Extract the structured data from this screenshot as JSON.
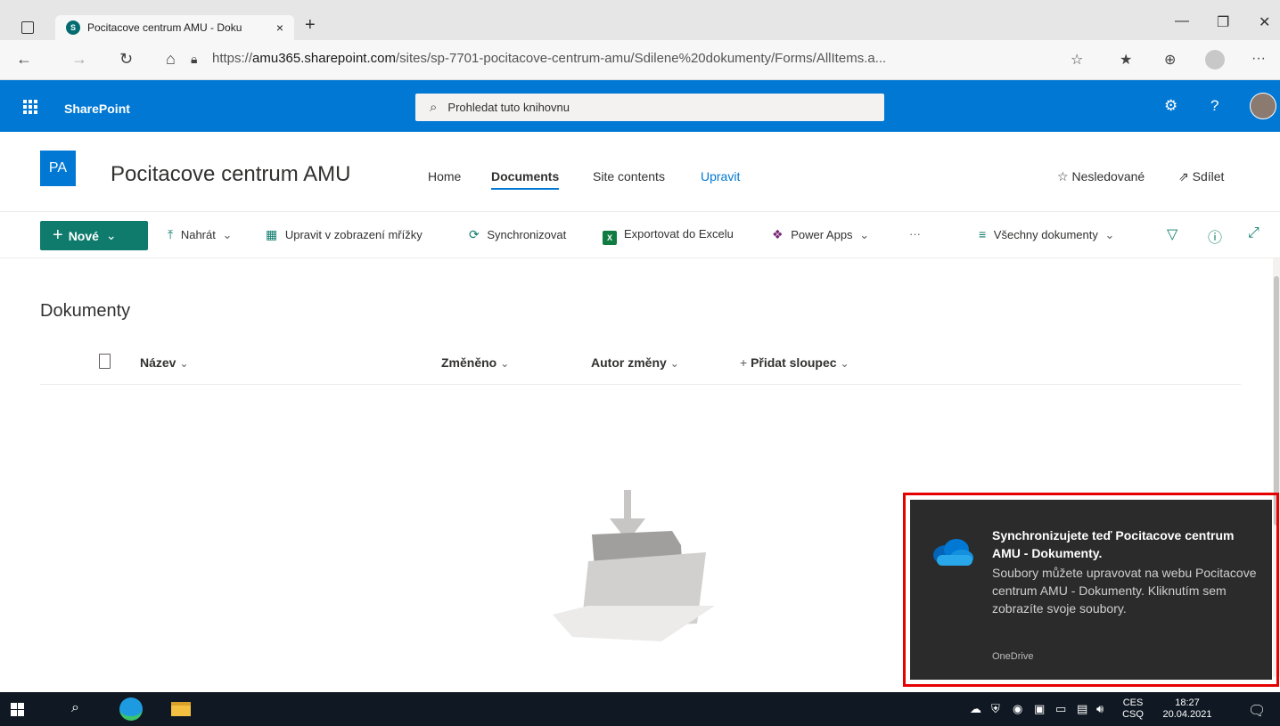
{
  "browser": {
    "tab_title": "Pocitacove centrum AMU - Doku",
    "tab_close": "×",
    "new_tab": "+",
    "url_prefix": "https://",
    "url_host": "amu365.sharepoint.com",
    "url_path": "/sites/sp-7701-pocitacove-centrum-amu/Sdilene%20dokumenty/Forms/AllItems.a...",
    "more": "···"
  },
  "suite": {
    "brand": "SharePoint",
    "search_placeholder": "Prohledat tuto knihovnu",
    "help": "?"
  },
  "site": {
    "logo": "PA",
    "title": "Pocitacove centrum AMU",
    "nav": [
      "Home",
      "Documents",
      "Site contents",
      "Upravit"
    ],
    "follow": "Nesledované",
    "share": "Sdílet"
  },
  "commands": {
    "new": "Nové",
    "upload": "Nahrát",
    "grid_edit": "Upravit v zobrazení mřížky",
    "sync": "Synchronizovat",
    "export": "Exportovat do Excelu",
    "powerapps": "Power Apps",
    "more": "···",
    "view": "Všechny dokumenty"
  },
  "library": {
    "title": "Dokumenty",
    "columns": [
      "Název",
      "Změněno",
      "Autor změny",
      "Přidat sloupec"
    ]
  },
  "toast": {
    "title": "Synchronizujete teď Pocitacove centrum AMU - Dokumenty.",
    "body": "Soubory můžete upravovat na webu Pocitacove centrum AMU - Dokumenty. Kliknutím sem zobrazíte svoje soubory.",
    "source": "OneDrive",
    "highlight_color": "#e60000"
  },
  "taskbar": {
    "lang_top": "CES",
    "lang_bottom": "CSQ",
    "time": "18:27",
    "date": "20.04.2021"
  },
  "colors": {
    "suite_bar": "#0078d4",
    "new_button": "#0f7b6c"
  }
}
